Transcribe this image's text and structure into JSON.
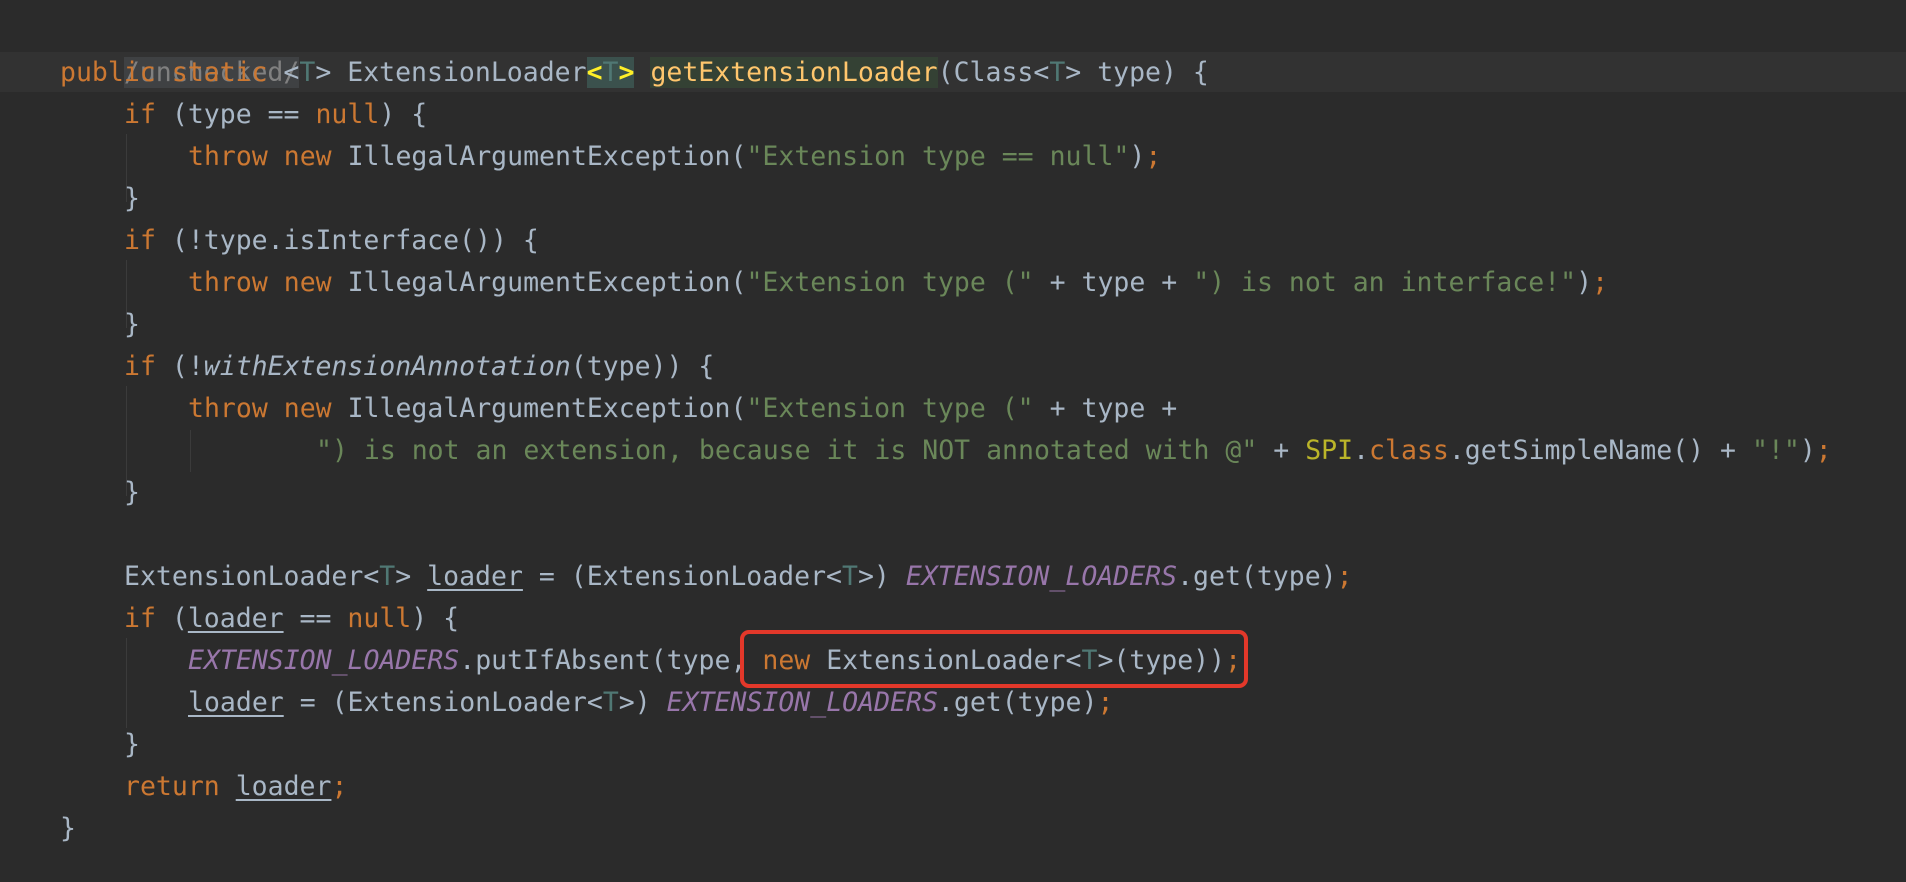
{
  "editor": {
    "colors": {
      "background": "#2b2b2b",
      "keyword": "#cc7832",
      "string": "#6a8759",
      "type_param": "#507874",
      "method_decl": "#ffc66d",
      "annotation_class": "#bbb529",
      "static_field": "#9876aa",
      "default_text": "#a9b7c6",
      "highlight_box": "#e3382a"
    },
    "l0": {
      "t0": "/unchecked/"
    },
    "l1": {
      "t0": "public",
      "t1": " ",
      "t2": "static",
      "t3": " <",
      "t4": "T",
      "t5": "> ExtensionLoader",
      "t6": "<",
      "t7": "T",
      "t8": ">",
      "t9": " ",
      "t10": "getExtensionLoader",
      "t11": "(Class<",
      "t12": "T",
      "t13": "> type) {"
    },
    "l2": {
      "t0": "if",
      "t1": " (type == ",
      "t2": "null",
      "t3": ") {"
    },
    "l3": {
      "t0": "throw",
      "t1": " ",
      "t2": "new",
      "t3": " IllegalArgumentException(",
      "t4": "\"Extension type == null\"",
      "t5": ")",
      "t6": ";"
    },
    "l4": {
      "t0": "}"
    },
    "l5": {
      "t0": "if",
      "t1": " (!type.isInterface()) {"
    },
    "l6": {
      "t0": "throw",
      "t1": " ",
      "t2": "new",
      "t3": " IllegalArgumentException(",
      "t4": "\"Extension type (\"",
      "t5": " + type + ",
      "t6": "\") is not an interface!\"",
      "t7": ")",
      "t8": ";"
    },
    "l7": {
      "t0": "}"
    },
    "l8": {
      "t0": "if",
      "t1": " (!",
      "t2": "withExtensionAnnotation",
      "t3": "(type)) {"
    },
    "l9": {
      "t0": "throw",
      "t1": " ",
      "t2": "new",
      "t3": " IllegalArgumentException(",
      "t4": "\"Extension type (\"",
      "t5": " + type +"
    },
    "l10": {
      "t0": "\") is not an extension, because it is NOT annotated with @\"",
      "t1": " + ",
      "t2": "SPI",
      "t3": ".",
      "t4": "class",
      "t5": ".getSimpleName() + ",
      "t6": "\"!\"",
      "t7": ")",
      "t8": ";"
    },
    "l11": {
      "t0": "}"
    },
    "l12": {
      "t0": "ExtensionLoader<",
      "t1": "T",
      "t2": "> ",
      "t3": "loader",
      "t4": " = (ExtensionLoader<",
      "t5": "T",
      "t6": ">) ",
      "t7": "EXTENSION_LOADERS",
      "t8": ".get(type)",
      "t9": ";"
    },
    "l13": {
      "t0": "if",
      "t1": " (",
      "t2": "loader",
      "t3": " == ",
      "t4": "null",
      "t5": ") {"
    },
    "l14": {
      "t0": "EXTENSION_LOADERS",
      "t1": ".putIfAbsent(type, ",
      "t2": "new",
      "t3": " ExtensionLoader<",
      "t4": "T",
      "t5": ">(type))",
      "t6": ";"
    },
    "l15": {
      "t0": "loader",
      "t1": " = (ExtensionLoader<",
      "t2": "T",
      "t3": ">) ",
      "t4": "EXTENSION_LOADERS",
      "t5": ".get(type)",
      "t6": ";"
    },
    "l16": {
      "t0": "}"
    },
    "l17": {
      "t0": "return",
      "t1": " ",
      "t2": "loader",
      "t3": ";"
    },
    "l18": {
      "t0": "}"
    }
  }
}
